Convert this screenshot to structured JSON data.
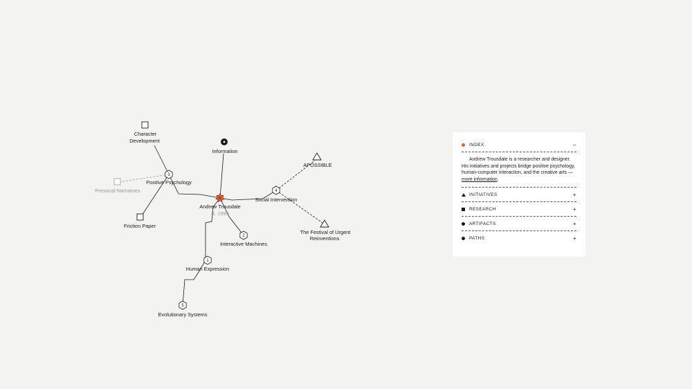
{
  "graph": {
    "center": {
      "name": "Andrew Trousdale",
      "born": "B. 1995"
    },
    "nodes": {
      "information": "Information",
      "character_development_1": "Character",
      "character_development_2": "Development",
      "positive_psychology": "Positive Psychology",
      "personal_narratives": "Personal Narratives",
      "friction_paper": "Friction Paper",
      "social_intervention": "Social Intervention",
      "apossible": "APOSSIBLE",
      "festival_1": "The Festival of Urgent",
      "festival_2": "Reinventions",
      "interactive_machines": "Interactive Machines",
      "human_expression": "Human Expression",
      "evolutionary_systems": "Evolutionary Systems"
    },
    "hub_numbers": {
      "positive_psychology": "3",
      "social_intervention": "4",
      "interactive_machines": "2",
      "human_expression": "1",
      "evolutionary_systems": "5"
    }
  },
  "panel": {
    "index": {
      "label": "INDEX",
      "toggle": "−",
      "marker": "orange-dot-icon",
      "color": "#ee5a2a"
    },
    "description": {
      "text": "Andrew Trousdale is a researcher and designer. His initiatives and projects bridge positive psychology, human-computer interaction, and the creative arts —",
      "link": "more information",
      "link_suffix": "."
    },
    "sections": [
      {
        "label": "INITIATIVES",
        "toggle": "+",
        "marker": "triangle-icon"
      },
      {
        "label": "RESEARCH",
        "toggle": "+",
        "marker": "square-icon"
      },
      {
        "label": "ARTIFACTS",
        "toggle": "+",
        "marker": "dot-icon"
      },
      {
        "label": "PATHS",
        "toggle": "+",
        "marker": "dot-icon"
      }
    ]
  },
  "colors": {
    "background": "#f3f3f1",
    "accent": "#ee5a2a",
    "ink": "#1a1a1a",
    "muted": "#9a9a9a"
  }
}
